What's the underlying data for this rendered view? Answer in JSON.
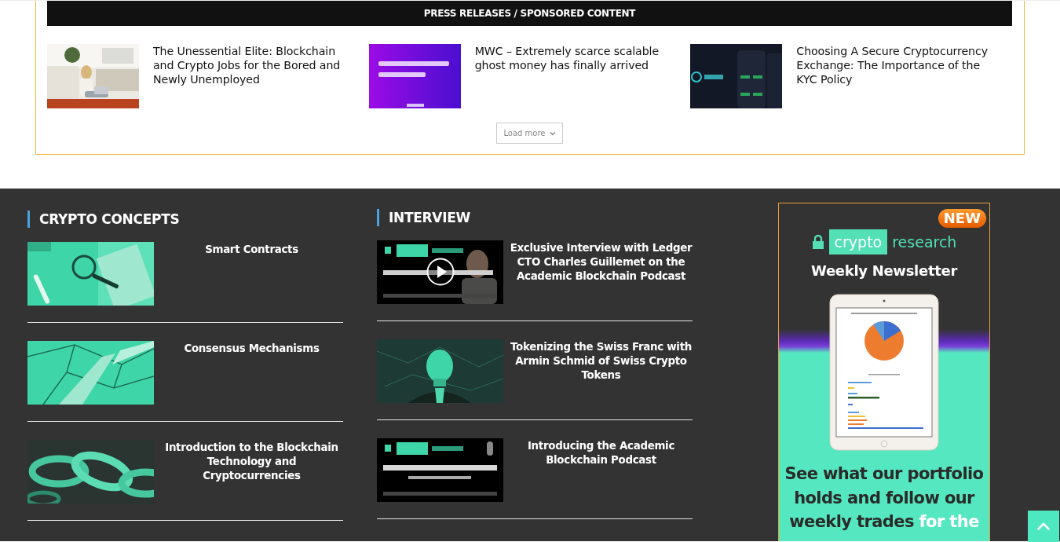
{
  "press_section": {
    "title": "PRESS RELEASES / SPONSORED CONTENT",
    "articles": [
      {
        "title": "The Unessential Elite: Blockchain and Crypto Jobs for the Bored and Newly Unemployed"
      },
      {
        "title": "MWC – Extremely scarce scalable ghost money has finally arrived"
      },
      {
        "title": "Choosing A Secure Cryptocurrency Exchange: The Importance of the KYC Policy"
      }
    ],
    "load_more": "Load more"
  },
  "columns": [
    {
      "title": "CRYPTO CONCEPTS",
      "articles": [
        {
          "title": "Smart Contracts",
          "has_play_button": false
        },
        {
          "title": "Consensus Mechanisms",
          "has_play_button": false
        },
        {
          "title": "Introduction to the Blockchain Technology and Cryptocurrencies",
          "has_play_button": false
        }
      ]
    },
    {
      "title": "INTERVIEW",
      "articles": [
        {
          "title": "Exclusive Interview with Ledger CTO Charles Guillemet on the Academic Blockchain Podcast",
          "has_play_button": true
        },
        {
          "title": "Tokenizing the Swiss Franc with Armin Schmid of Swiss Crypto Tokens",
          "has_play_button": false
        },
        {
          "title": "Introducing the Academic Blockchain Podcast",
          "has_play_button": false
        }
      ]
    }
  ],
  "ad": {
    "badge": "NEW",
    "logo_box": "crypto",
    "logo_word": "research",
    "subtitle": "Weekly Newsletter",
    "headline": "See what our portfolio holds and follow our weekly trades ",
    "headline_highlight": "for the"
  }
}
